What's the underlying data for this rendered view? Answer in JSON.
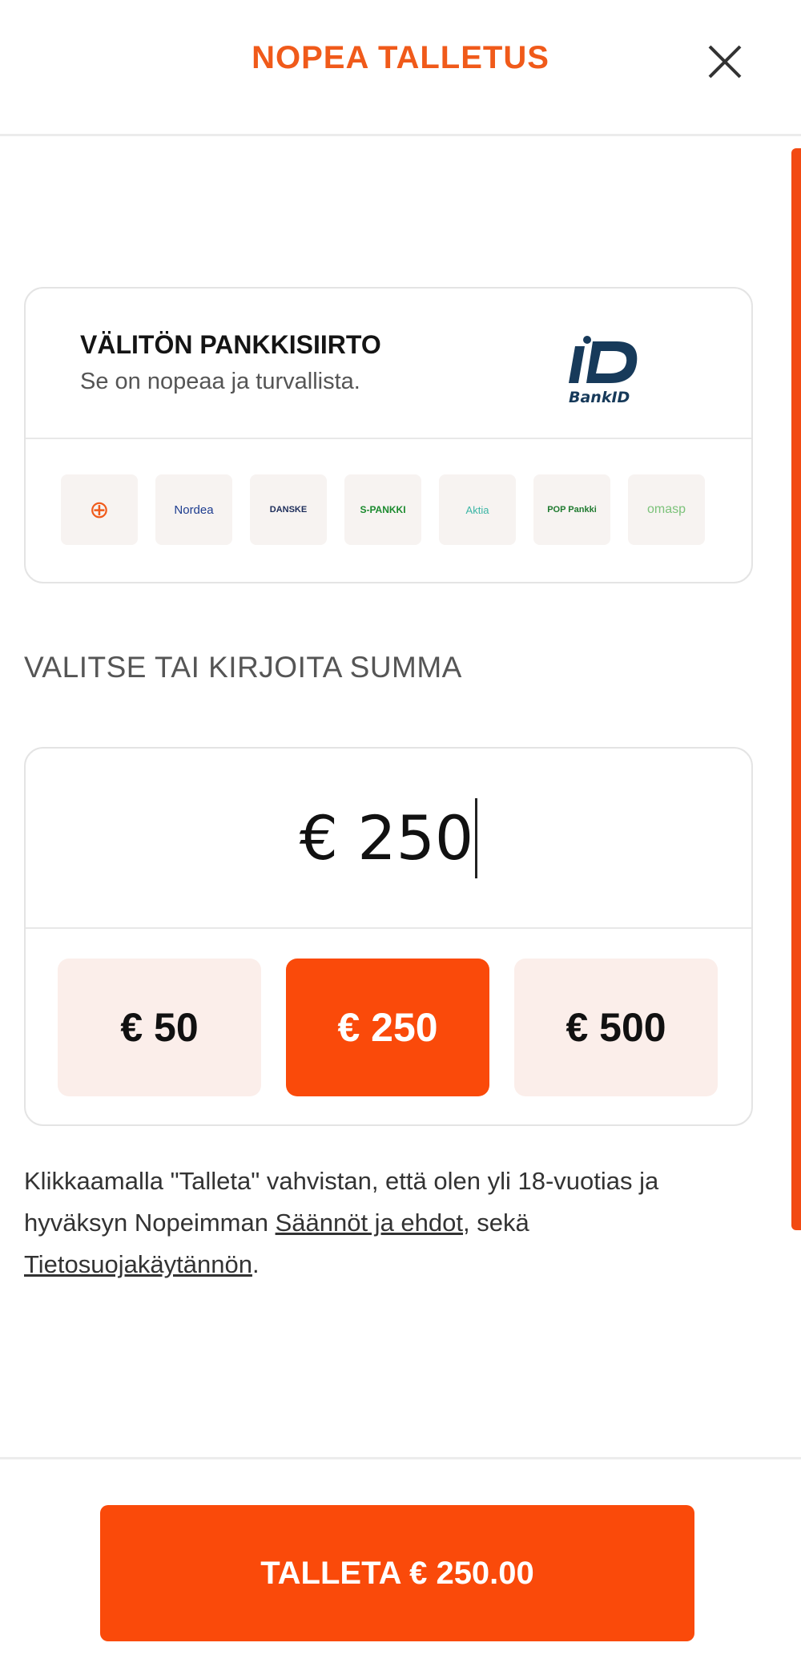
{
  "header": {
    "title": "NOPEA TALLETUS",
    "close_icon": "close-icon"
  },
  "bank_card": {
    "title": "VÄLITÖN PANKKISIIRTO",
    "subtitle": "Se on nopeaa ja turvallista.",
    "logo_icon": "bankid-logo",
    "banks": [
      {
        "icon": "handelsbanken-icon",
        "label": "⊕",
        "color": "#f05a1a"
      },
      {
        "icon": "nordea-icon",
        "label": "Nordea",
        "color": "#1d3c8f"
      },
      {
        "icon": "danske-bank-icon",
        "label": "DANSKE",
        "color": "#1d2d5a"
      },
      {
        "icon": "s-pankki-icon",
        "label": "S-PANKKI",
        "color": "#1b8a2e"
      },
      {
        "icon": "aktia-icon",
        "label": "Aktia",
        "color": "#3bb5a5"
      },
      {
        "icon": "pop-pankki-icon",
        "label": "POP Pankki",
        "color": "#1f7a2f"
      },
      {
        "icon": "omasp-icon",
        "label": "omasp",
        "color": "#7cc27a"
      }
    ]
  },
  "amount": {
    "heading": "VALITSE TAI KIRJOITA SUMMA",
    "current_value": "€ 250",
    "presets": [
      "€ 50",
      "€ 250",
      "€ 500"
    ],
    "selected_preset": "€ 250"
  },
  "terms": {
    "text_part1": "Klikkaamalla \"Talleta\" vahvistan, että olen yli 18-vuotias ja hyväksyn Nopeimman ",
    "link_terms": "Säännöt ja ehdot",
    "text_part2": ", sekä ",
    "link_privacy": "Tietosuojakäytännön",
    "text_part3": "."
  },
  "footer": {
    "submit_label": "TALLETA € 250.00"
  },
  "colors": {
    "accent": "#fa4a0a",
    "title": "#f05a1a",
    "preset_bg": "#fbeeea"
  }
}
